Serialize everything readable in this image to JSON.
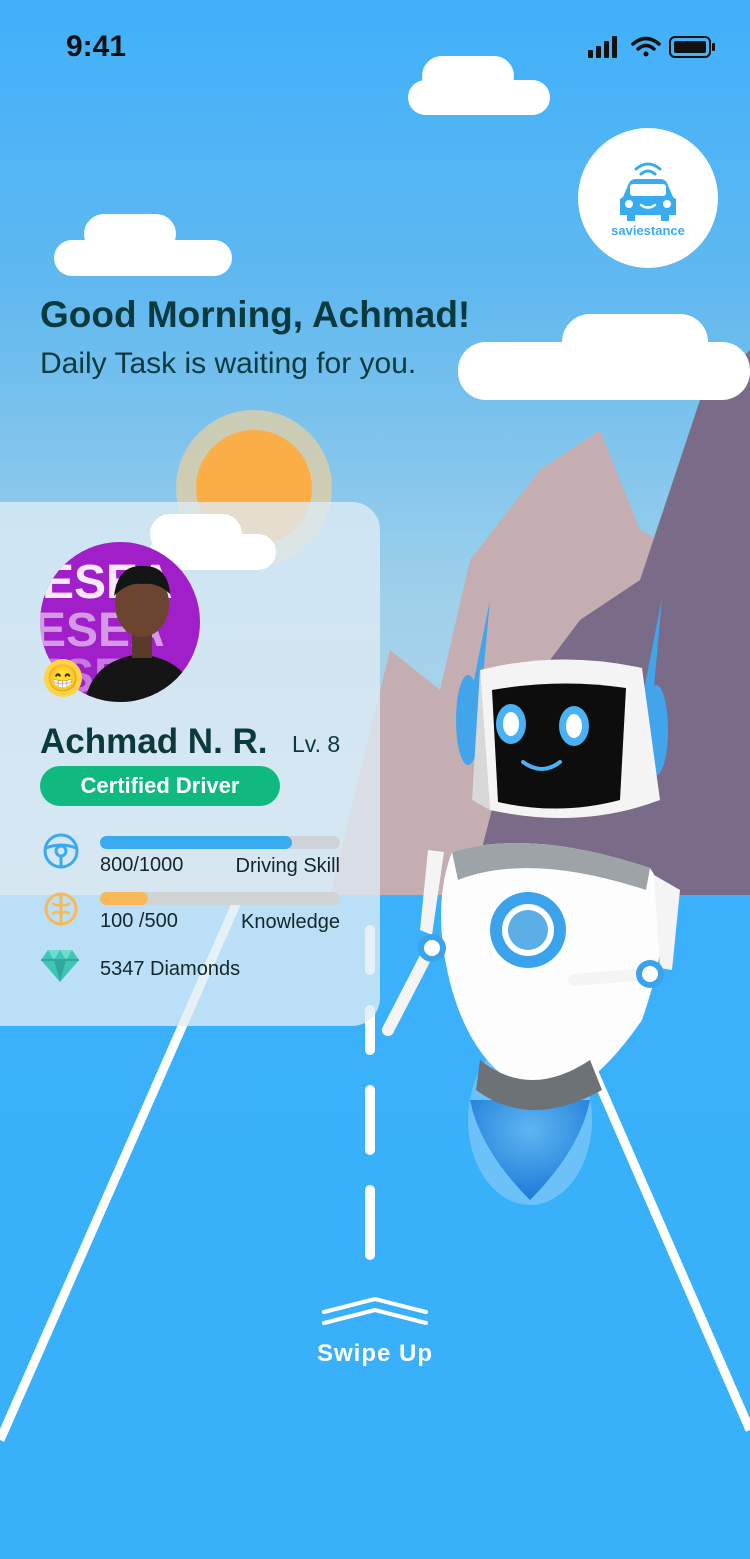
{
  "status_bar": {
    "time": "9:41"
  },
  "brand": {
    "name": "saviestance"
  },
  "greeting": {
    "title": "Good Morning, Achmad!",
    "subtitle": "Daily Task is waiting for you."
  },
  "profile": {
    "name": "Achmad N. R.",
    "level": "Lv. 8",
    "badge": "Certified Driver",
    "avatar_emoji": "😁",
    "stats": [
      {
        "icon": "steering-wheel-icon",
        "value": "800/1000",
        "label": "Driving Skill",
        "progress": 0.8,
        "color": "#3aaaf0"
      },
      {
        "icon": "brain-icon",
        "value": "100 /500",
        "label": "Knowledge",
        "progress": 0.2,
        "color": "#f8b857"
      }
    ],
    "diamonds": {
      "icon": "diamond-icon",
      "value": "5347 Diamonds"
    }
  },
  "swipe": {
    "label": "Swipe Up"
  },
  "colors": {
    "sky": "#3fb0fb",
    "road": "#38b0fa",
    "accent_green": "#10b980",
    "text_dark": "#0b3a3e"
  }
}
